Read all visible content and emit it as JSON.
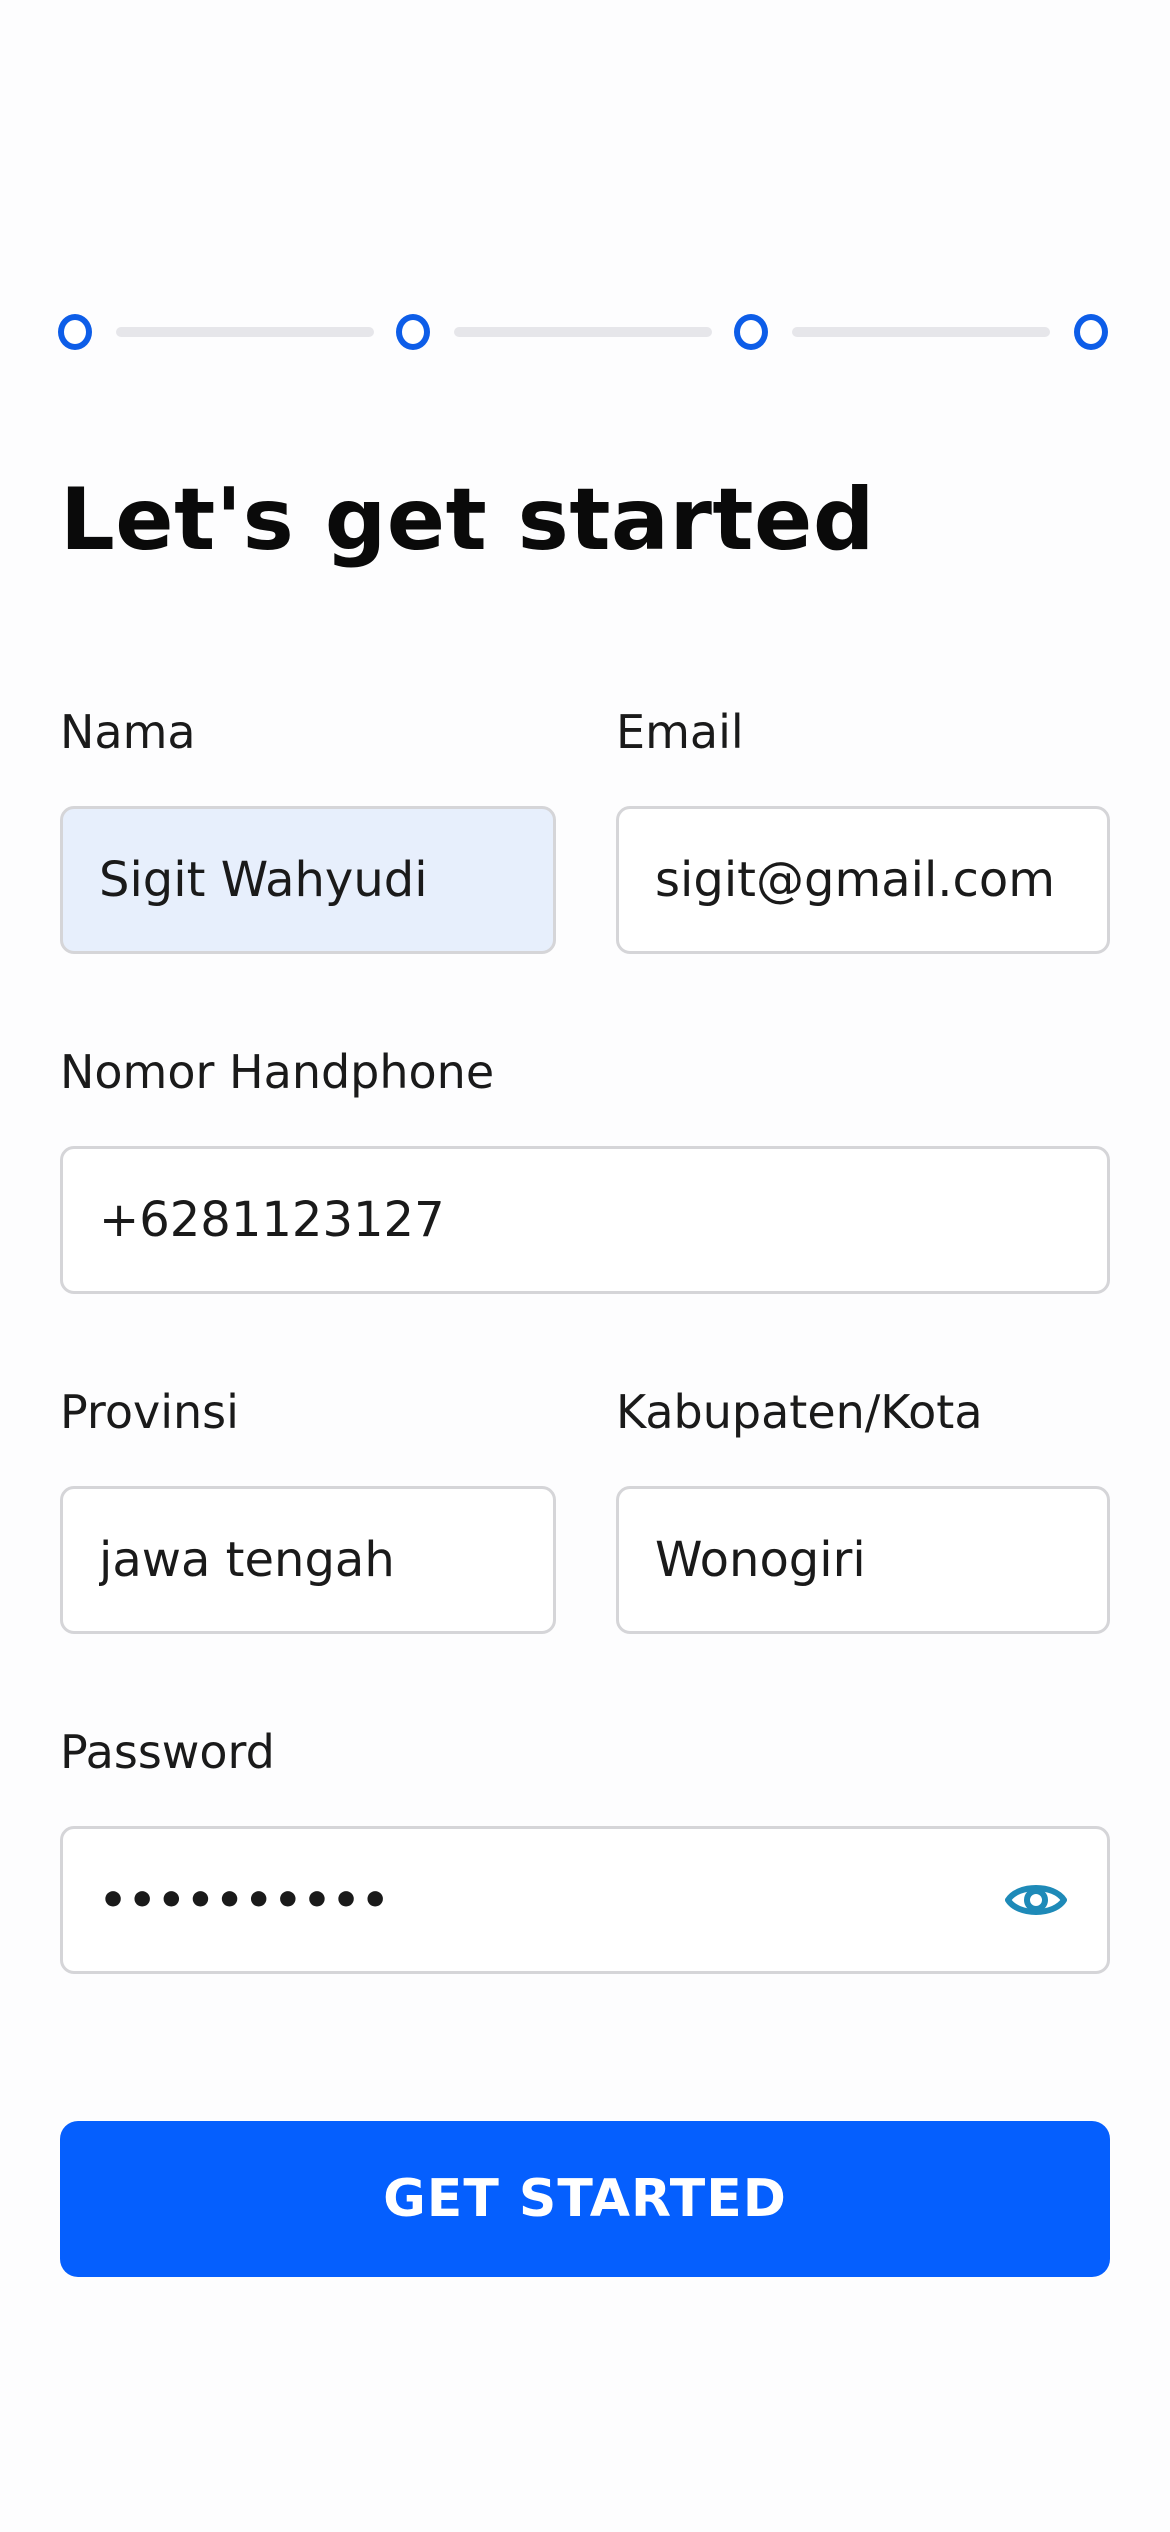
{
  "colors": {
    "accent": "#055ffe",
    "step_dot": "#0d5de8",
    "step_line": "#e6e6ea",
    "active_field_bg": "#e7effc",
    "field_border": "#d5d5d8",
    "eye_icon": "#1e8ab8"
  },
  "stepper": {
    "steps": 4,
    "icon": "circle-step-icon"
  },
  "header": {
    "title": "Let's get started"
  },
  "form": {
    "nama": {
      "label": "Nama",
      "value": "Sigit Wahyudi"
    },
    "email": {
      "label": "Email",
      "value": "sigit@gmail.com"
    },
    "phone": {
      "label": "Nomor Handphone",
      "value": "+6281123127"
    },
    "provinsi": {
      "label": "Provinsi",
      "value": "jawa tengah"
    },
    "kota": {
      "label": "Kabupaten/Kota",
      "value": "Wonogiri"
    },
    "password": {
      "label": "Password",
      "value": "••••••••••",
      "toggle_icon": "eye-icon"
    }
  },
  "actions": {
    "submit_label": "GET STARTED"
  }
}
